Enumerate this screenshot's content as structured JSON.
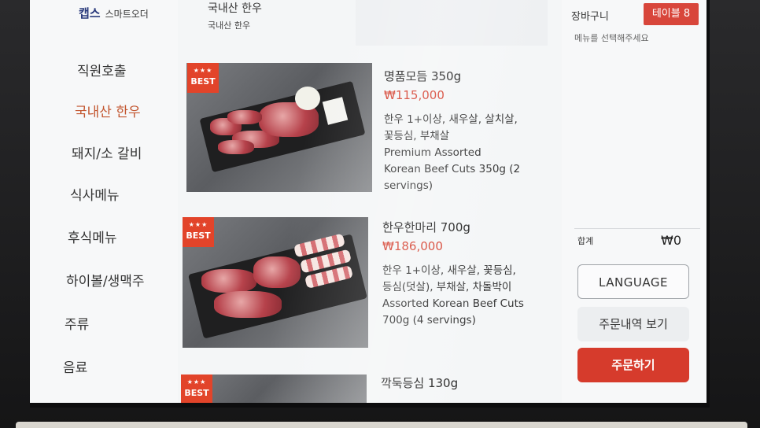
{
  "brand": {
    "logo": "캡스",
    "subtitle": "스마트오더"
  },
  "header": {
    "category_title": "국내산 한우",
    "category_sub": "국내산 한우"
  },
  "sidebar": {
    "items": [
      {
        "label": "직원호출",
        "active": false
      },
      {
        "label": "국내산 한우",
        "active": true
      },
      {
        "label": "돼지/소 갈비",
        "active": false
      },
      {
        "label": "식사메뉴",
        "active": false
      },
      {
        "label": "후식메뉴",
        "active": false
      },
      {
        "label": "하이볼/생맥주",
        "active": false
      },
      {
        "label": "주류",
        "active": false
      },
      {
        "label": "음료",
        "active": false
      }
    ]
  },
  "menu": {
    "items": [
      {
        "badge_stars": "★★★",
        "badge_label": "BEST",
        "name": "명품모듬 350g",
        "price": "₩115,000",
        "desc_lines": [
          "한우 1+이상, 새우살, 살치살,",
          "꽃등심, 부채살",
          "Premium Assorted",
          "Korean Beef Cuts 350g (2",
          "servings)"
        ]
      },
      {
        "badge_stars": "★★★",
        "badge_label": "BEST",
        "name": "한우한마리 700g",
        "price": "₩186,000",
        "desc_lines": [
          "한우 1+이상, 새우살, 꽃등심,",
          "등심(덧살), 부채살, 차돌박이",
          "Assorted Korean Beef Cuts",
          "700g  (4 servings)"
        ]
      },
      {
        "badge_stars": "★★★",
        "badge_label": "BEST",
        "name": "깍둑등심 130g",
        "price": "",
        "desc_lines": []
      }
    ]
  },
  "cart": {
    "title": "장바구니",
    "table": "테이블 8",
    "hint": "메뉴를 선택해주세요",
    "total_label": "합계",
    "total_value": "₩0",
    "language_button": "LANGUAGE",
    "history_button": "주문내역 보기",
    "order_button": "주문하기"
  },
  "colors": {
    "accent": "#d63b2c",
    "active_nav": "#c2552e",
    "price": "#d5402f",
    "badge": "#e2442a"
  }
}
